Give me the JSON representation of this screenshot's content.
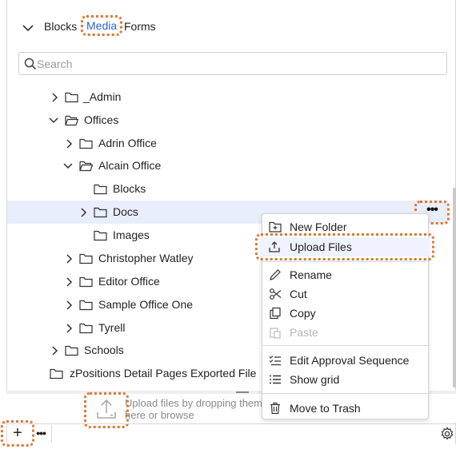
{
  "tabs": {
    "items": [
      "Blocks",
      "Media",
      "Forms"
    ],
    "active": "Media"
  },
  "search": {
    "placeholder": "Search"
  },
  "tree": {
    "items": [
      {
        "label": "_Admin",
        "expanded": false
      },
      {
        "label": "Offices",
        "expanded": true
      },
      {
        "label": "Adrin Office",
        "expanded": false
      },
      {
        "label": "Alcain Office",
        "expanded": true
      },
      {
        "label": "Blocks"
      },
      {
        "label": "Docs",
        "expanded": false,
        "selected": true
      },
      {
        "label": "Images"
      },
      {
        "label": "Christopher Watley",
        "expanded": false
      },
      {
        "label": "Editor Office",
        "expanded": false
      },
      {
        "label": "Sample Office One",
        "expanded": false
      },
      {
        "label": "Tyrell",
        "expanded": false
      },
      {
        "label": "Schools",
        "expanded": false
      },
      {
        "label": "zPositions Detail Pages Exported File"
      }
    ]
  },
  "context_menu": {
    "items": [
      {
        "label": "New Folder",
        "icon": "new-folder-icon"
      },
      {
        "label": "Upload Files",
        "icon": "upload-icon"
      },
      {
        "label": "Rename",
        "icon": "pencil-icon"
      },
      {
        "label": "Cut",
        "icon": "scissors-icon"
      },
      {
        "label": "Copy",
        "icon": "copy-icon"
      },
      {
        "label": "Paste",
        "icon": "paste-icon",
        "disabled": true
      },
      {
        "label": "Edit Approval Sequence",
        "icon": "approval-list-icon"
      },
      {
        "label": "Show grid",
        "icon": "list-icon"
      },
      {
        "label": "Move to Trash",
        "icon": "trash-icon"
      }
    ]
  },
  "dropzone": {
    "text": "Upload files by dropping them here or browse"
  },
  "bottombar": {
    "add": "+",
    "more": "•••"
  },
  "colors": {
    "accent": "#2a63d6",
    "highlight": "#e3762f",
    "selected_row": "#e8eefb"
  }
}
